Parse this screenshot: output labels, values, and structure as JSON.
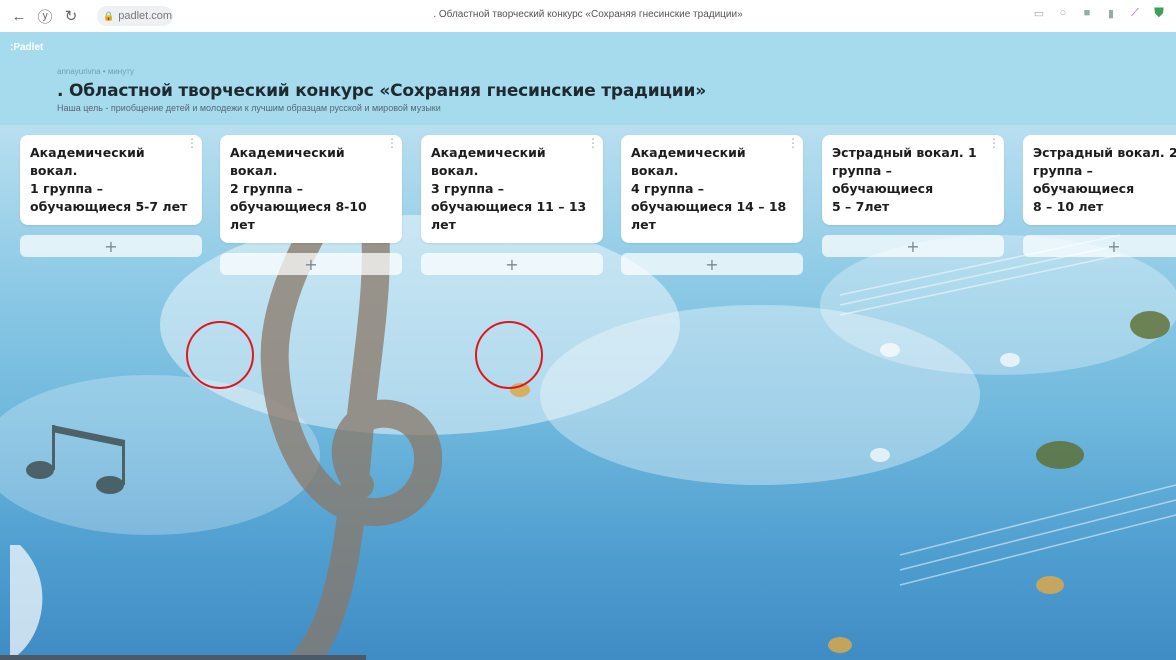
{
  "browser": {
    "url": "padlet.com",
    "tab_title": ". Областной творческий конкурс «Сохраняя гнесинские традиции»"
  },
  "padlet": {
    "logo": ":Padlet",
    "meta": "annayurivna • минуту",
    "title": ". Областной творческий конкурс «Сохраняя гнесинские традиции»",
    "description": "Наша цель - приобщение детей и молодежи к лучшим образцам русской и мировой музыки"
  },
  "columns": [
    {
      "title": "Академический вокал.\n1 группа –\nобучающиеся 5-7 лет",
      "add": "+"
    },
    {
      "title": "Академический вокал.\n2 группа –\nобучающиеся 8-10 лет",
      "add": "+"
    },
    {
      "title": "Академический вокал.\n3 группа –\nобучающиеся 11 – 13\nлет",
      "add": "+"
    },
    {
      "title": "Академический вокал.\n4 группа –\nобучающиеся 14 – 18\nлет",
      "add": "+"
    },
    {
      "title": "Эстрадный вокал. 1\nгруппа – обучающиеся\n5 – 7лет",
      "add": "+"
    },
    {
      "title": "Эстрадный вокал. 2\nгруппа – обучающиеся\n8 – 10 лет",
      "add": "+"
    }
  ],
  "icons": {
    "back": "arrow-left-icon",
    "reload": "reload-icon",
    "lock": "lock-icon",
    "menu": "kebab-menu-icon"
  },
  "colors": {
    "header_bg": "#a6dbed",
    "annotation_red": "#e0161f"
  }
}
